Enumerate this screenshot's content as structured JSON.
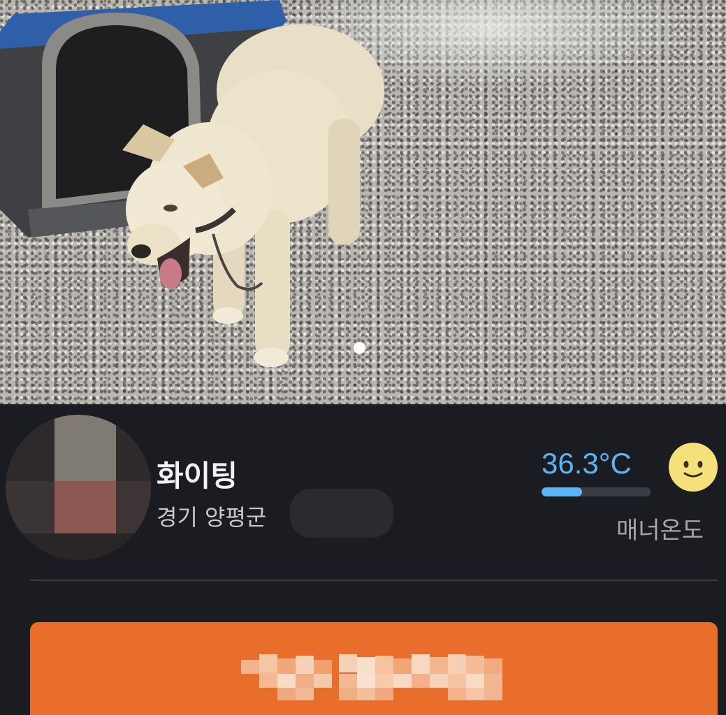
{
  "photo": {
    "subject": "white dog in front of dog house",
    "page_indicator_count": 1,
    "active_page": 1
  },
  "seller": {
    "nickname": "화이팅",
    "location": "경기 양평군",
    "avatar_blurred": true
  },
  "manner": {
    "temperature_text": "36.3°C",
    "temperature_value": 36.3,
    "bar_fill_fraction": 0.37,
    "label": "매너온도",
    "face_icon": "smiling-face-icon",
    "accent_color": "#5ab5f2"
  },
  "cta": {
    "label_obscured": true,
    "background_color": "#ea6e2b"
  },
  "colors": {
    "background": "#1b1c21",
    "divider": "#3c3d44",
    "text_primary": "#f2f2f2",
    "text_secondary": "#c9c9cc"
  }
}
